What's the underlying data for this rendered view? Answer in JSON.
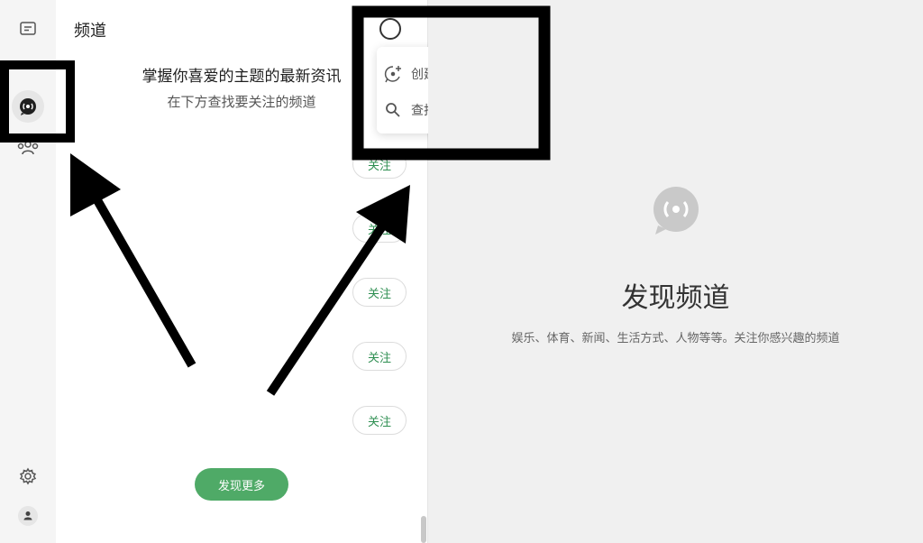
{
  "sidebar": {
    "icons": [
      "message-icon",
      "status-icon",
      "channels-icon",
      "contacts-icon",
      "settings-icon",
      "profile-icon"
    ]
  },
  "panel": {
    "title": "频道",
    "headline": "掌握你喜爱的主题的最新资讯",
    "subline": "在下方查找要关注的频道",
    "follow_label": "关注",
    "discover_more": "发现更多"
  },
  "menu": {
    "items": [
      {
        "label": "创建频道",
        "icon": "create-channel-icon"
      },
      {
        "label": "查找频道",
        "icon": "search-icon"
      }
    ]
  },
  "main": {
    "title": "发现频道",
    "description": "娱乐、体育、新闻、生活方式、人物等等。关注你感兴趣的频道"
  },
  "colors": {
    "accent": "#4faa67",
    "follow_text": "#2f8f52"
  }
}
